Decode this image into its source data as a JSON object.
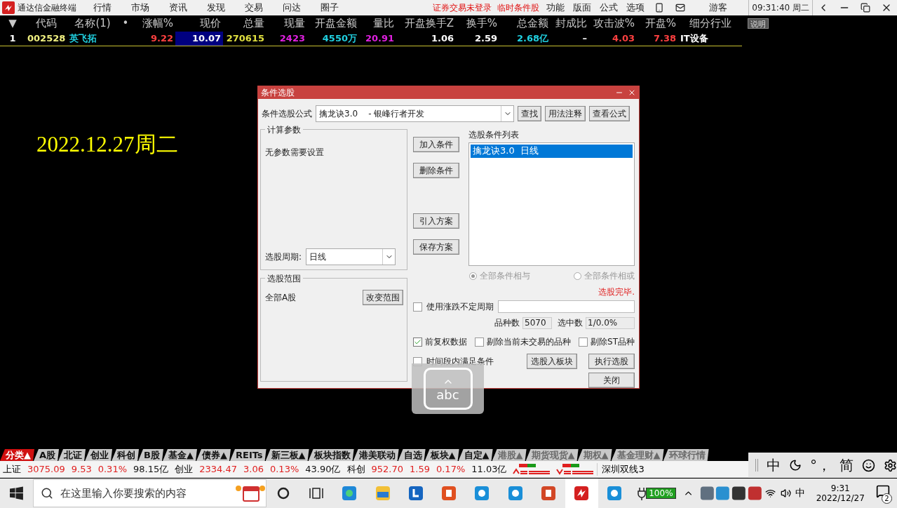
{
  "menu_bar": {
    "app_title": "通达信金融终端",
    "items": [
      "行情",
      "市场",
      "资讯",
      "发现",
      "交易",
      "问达",
      "圈子"
    ],
    "notices": [
      "证券交易未登录",
      "临时条件股"
    ],
    "tools": [
      "功能",
      "版面",
      "公式",
      "选项"
    ],
    "user": "游客",
    "clock": "09:31:40 周二"
  },
  "quote_table": {
    "columns": [
      {
        "label": "▼",
        "kind": "menu"
      },
      {
        "label": "代码",
        "kind": "text"
      },
      {
        "label": "名称(1)",
        "kind": "text"
      },
      {
        "label": "•",
        "kind": "dot"
      },
      {
        "label": "涨幅%",
        "kind": "num"
      },
      {
        "label": "现价",
        "kind": "num"
      },
      {
        "label": "总量",
        "kind": "num"
      },
      {
        "label": "现量",
        "kind": "num"
      },
      {
        "label": "开盘金额",
        "kind": "num"
      },
      {
        "label": "量比",
        "kind": "num"
      },
      {
        "label": "开盘换手Z",
        "kind": "num"
      },
      {
        "label": "换手%",
        "kind": "num"
      },
      {
        "label": "总金额",
        "kind": "num"
      },
      {
        "label": "封成比",
        "kind": "num"
      },
      {
        "label": "攻击波%",
        "kind": "num"
      },
      {
        "label": "开盘%",
        "kind": "num"
      },
      {
        "label": "细分行业",
        "kind": "text"
      }
    ],
    "help_button": "说明",
    "rows": [
      {
        "cells": [
          {
            "text": "1",
            "selected": false
          },
          {
            "text": "002528",
            "selected": false
          },
          {
            "text": "英飞拓",
            "selected": false
          },
          {
            "text": "",
            "selected": false
          },
          {
            "text": "9.22",
            "selected": false
          },
          {
            "text": "10.07",
            "selected": true
          },
          {
            "text": "270615",
            "selected": false
          },
          {
            "text": "2423",
            "selected": false
          },
          {
            "text": "4550万",
            "selected": false
          },
          {
            "text": "20.91",
            "selected": false
          },
          {
            "text": "1.06",
            "selected": false
          },
          {
            "text": "2.59",
            "selected": false
          },
          {
            "text": "2.68亿",
            "selected": false
          },
          {
            "text": "–",
            "selected": false
          },
          {
            "text": "4.03",
            "selected": false
          },
          {
            "text": "7.38",
            "selected": false
          },
          {
            "text": "IT设备",
            "selected": false
          }
        ]
      }
    ]
  },
  "date_caption": "2022.12.27周二",
  "dialog": {
    "title": "条件选股",
    "formula_label": "条件选股公式",
    "formula_value": "擒龙诀3.0    - 银峰行者开发",
    "formula_buttons": [
      "查找",
      "用法注释",
      "查看公式"
    ],
    "params_group": {
      "title": "计算参数",
      "message": "无参数需要设置",
      "period_label": "选股周期:",
      "period_value": "日线"
    },
    "range_group": {
      "title": "选股范围",
      "value": "全部A股",
      "button": "改变范围"
    },
    "side_buttons": [
      [
        "加入条件",
        "删除条件"
      ],
      [
        "引入方案",
        "保存方案"
      ]
    ],
    "list_title": "选股条件列表",
    "conditions": [
      {
        "text": "擒龙诀3.0  日线",
        "selected": true
      }
    ],
    "combine_options": [
      {
        "label": "全部条件相与",
        "selected": true,
        "disabled": true
      },
      {
        "label": "全部条件相或",
        "selected": false,
        "disabled": true
      }
    ],
    "status": "选股完毕.",
    "variable_period": {
      "label": "使用涨跌不定周期",
      "checked": false
    },
    "stock_count_label": "品种数",
    "stock_count": "5070",
    "selected_count_label": "选中数",
    "selected_count": "1/0.0%",
    "options": [
      {
        "label": "前复权数据",
        "checked": true
      },
      {
        "label": "剔除当前未交易的品种",
        "checked": false
      },
      {
        "label": "剔除ST品种",
        "checked": false
      }
    ],
    "time_condition": {
      "label": "时间段内满足条件",
      "checked": false
    },
    "action_buttons": [
      "选股入板块",
      "执行选股"
    ],
    "close_button": "关闭"
  },
  "ime_overlay": {
    "text": "abc"
  },
  "category_tabs": [
    {
      "label": "分类▲",
      "selected": true,
      "disabled": false
    },
    {
      "label": "A股",
      "selected": false,
      "disabled": false
    },
    {
      "label": "北证",
      "selected": false,
      "disabled": false
    },
    {
      "label": "创业",
      "selected": false,
      "disabled": false
    },
    {
      "label": "科创",
      "selected": false,
      "disabled": false
    },
    {
      "label": "B股",
      "selected": false,
      "disabled": false
    },
    {
      "label": "基金▲",
      "selected": false,
      "disabled": false
    },
    {
      "label": "债券▲",
      "selected": false,
      "disabled": false
    },
    {
      "label": "REITs",
      "selected": false,
      "disabled": false
    },
    {
      "label": "新三板▲",
      "selected": false,
      "disabled": false
    },
    {
      "label": "板块指数",
      "selected": false,
      "disabled": false
    },
    {
      "label": "港美联动",
      "selected": false,
      "disabled": false
    },
    {
      "label": "自选",
      "selected": false,
      "disabled": false
    },
    {
      "label": "板块▲",
      "selected": false,
      "disabled": false
    },
    {
      "label": "自定▲",
      "selected": false,
      "disabled": false
    },
    {
      "label": "港股▲",
      "selected": false,
      "disabled": true
    },
    {
      "label": "期货现货▲",
      "selected": false,
      "disabled": true
    },
    {
      "label": "期权▲",
      "selected": false,
      "disabled": true
    },
    {
      "label": "基金理财▲",
      "selected": false,
      "disabled": true
    },
    {
      "label": "环球行情",
      "selected": false,
      "disabled": true
    }
  ],
  "index_bar": {
    "items": [
      {
        "kind": "label",
        "text": "上证"
      },
      {
        "kind": "value",
        "text": "3075.09",
        "color": "#e02020"
      },
      {
        "kind": "value",
        "text": "9.53",
        "color": "#e02020"
      },
      {
        "kind": "value",
        "text": "0.31%",
        "color": "#e02020"
      },
      {
        "kind": "amount",
        "text": "98.15亿"
      },
      {
        "kind": "label",
        "text": "创业"
      },
      {
        "kind": "value",
        "text": "2334.47",
        "color": "#e02020"
      },
      {
        "kind": "value",
        "text": "3.06",
        "color": "#e02020"
      },
      {
        "kind": "value",
        "text": "0.13%",
        "color": "#e02020"
      },
      {
        "kind": "amount",
        "text": "43.90亿"
      },
      {
        "kind": "label",
        "text": "科创"
      },
      {
        "kind": "value",
        "text": "952.70",
        "color": "#e02020"
      },
      {
        "kind": "value",
        "text": "1.59",
        "color": "#e02020"
      },
      {
        "kind": "value",
        "text": "0.17%",
        "color": "#e02020"
      },
      {
        "kind": "amount",
        "text": "11.03亿"
      }
    ],
    "line_label": "深圳双线3"
  },
  "ime_bar": {
    "items": [
      {
        "kind": "text",
        "text": "中"
      },
      {
        "kind": "moon"
      },
      {
        "kind": "text",
        "text": "°，"
      },
      {
        "kind": "text",
        "text": "简"
      },
      {
        "kind": "smiley"
      },
      {
        "kind": "gear"
      }
    ]
  },
  "taskbar": {
    "search_placeholder": "在这里输入你要搜索的内容",
    "battery": "100%",
    "ime": "中",
    "time": "9:31",
    "date": "2022/12/27",
    "notifications": "2"
  }
}
